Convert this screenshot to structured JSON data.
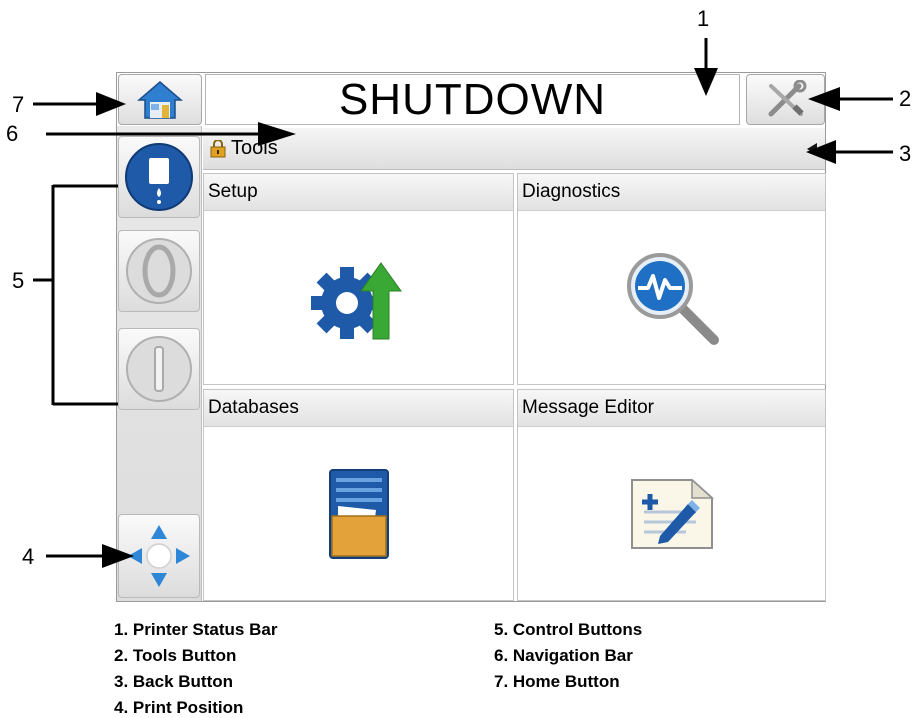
{
  "status_bar": {
    "text": "SHUTDOWN"
  },
  "nav_bar": {
    "crumb": "Tools"
  },
  "tiles": [
    {
      "label": "Setup",
      "icon": "gear-with-up-arrow-icon"
    },
    {
      "label": "Diagnostics",
      "icon": "magnifier-waveform-icon"
    },
    {
      "label": "Databases",
      "icon": "database-folder-icon"
    },
    {
      "label": "Message Editor",
      "icon": "document-pencil-icon"
    }
  ],
  "callouts": {
    "c1": "1",
    "c2": "2",
    "c3": "3",
    "c4": "4",
    "c5": "5",
    "c6": "6",
    "c7": "7"
  },
  "legend": {
    "l1": "1. Printer Status Bar",
    "l2": "2. Tools Button",
    "l3": "3. Back Button",
    "l4": "4. Print Position",
    "l5": "5. Control Buttons",
    "l6": "6. Navigation Bar",
    "l7": "7. Home Button"
  },
  "colors": {
    "accent_blue": "#1e5aa8",
    "green_arrow": "#3aa835",
    "folder_orange": "#e3a23a"
  }
}
